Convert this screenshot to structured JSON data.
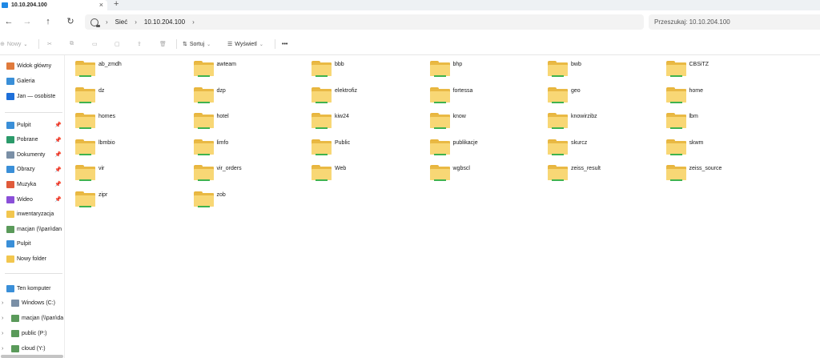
{
  "tab": {
    "title": "10.10.204.100",
    "close": "×",
    "new_tab": "+"
  },
  "nav": {
    "back": "←",
    "forward": "→",
    "up": "↑",
    "refresh": "↻",
    "expand": "›"
  },
  "breadcrumb": [
    "Sieć",
    "10.10.204.100"
  ],
  "search": {
    "placeholder": "Przeszukaj: 10.10.204.100"
  },
  "toolbar": {
    "new_label": "Nowy",
    "sort_label": "Sortuj",
    "view_label": "Wyświetl",
    "more_label": "•••"
  },
  "sidebar": {
    "top": [
      {
        "label": "Widok główny",
        "icon": "home-icon"
      },
      {
        "label": "Galeria",
        "icon": "gallery-icon"
      },
      {
        "label": "Jan — osobiste",
        "icon": "cloud-icon"
      }
    ],
    "quick": [
      {
        "label": "Pulpit",
        "icon": "desktop-icon",
        "pinned": true
      },
      {
        "label": "Pobrane",
        "icon": "download-icon",
        "pinned": true
      },
      {
        "label": "Dokumenty",
        "icon": "documents-icon",
        "pinned": true
      },
      {
        "label": "Obrazy",
        "icon": "pictures-icon",
        "pinned": true
      },
      {
        "label": "Muzyka",
        "icon": "music-icon",
        "pinned": true
      },
      {
        "label": "Wideo",
        "icon": "video-icon",
        "pinned": true
      },
      {
        "label": "inwentaryzacja",
        "icon": "folder-icon",
        "pinned": false
      },
      {
        "label": "macjan (\\\\pan\\dan",
        "icon": "network-drive-icon",
        "pinned": false
      },
      {
        "label": "Pulpit",
        "icon": "desktop-icon",
        "pinned": false
      },
      {
        "label": "Nowy folder",
        "icon": "folder-icon",
        "pinned": false
      }
    ],
    "pin_glyph": "📌",
    "computer": {
      "label": "Ten komputer",
      "icon": "computer-icon"
    },
    "drives": [
      {
        "label": "Windows  (C:)",
        "icon": "drive-icon"
      },
      {
        "label": "macjan (\\\\pan\\da",
        "icon": "network-drive-icon"
      },
      {
        "label": "public (P:)",
        "icon": "network-drive-icon"
      },
      {
        "label": "cloud (Y:)",
        "icon": "network-drive-icon"
      }
    ]
  },
  "folders": [
    "ab_zmdh",
    "awteam",
    "bbb",
    "bhp",
    "bwb",
    "CBSiTZ",
    "dz",
    "dzp",
    "elektrofiz",
    "fortessa",
    "geo",
    "home",
    "homes",
    "hotel",
    "kiw24",
    "know",
    "knowirzibz",
    "lbm",
    "lbmbio",
    "limfo",
    "Public",
    "publikacje",
    "skurcz",
    "skwm",
    "vir",
    "vir_orders",
    "Web",
    "wgbscl",
    "zeiss_result",
    "zeiss_source",
    "zipr",
    "zob"
  ],
  "colors": {
    "folder_front": "#f8d775",
    "folder_back": "#e9b944",
    "share_indicator": "#3fb34f",
    "accent": "#1e88e5"
  }
}
